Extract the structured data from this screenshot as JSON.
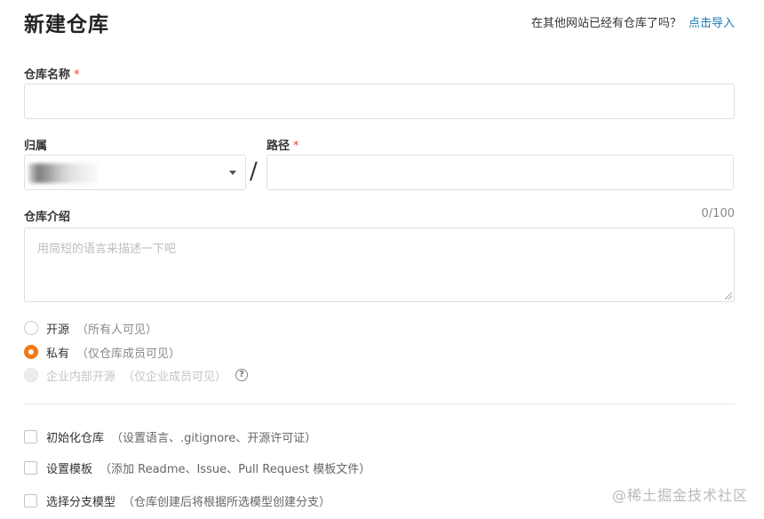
{
  "header": {
    "title": "新建仓库",
    "import_prompt": "在其他网站已经有仓库了吗？",
    "import_link": "点击导入"
  },
  "form": {
    "repo_name": {
      "label": "仓库名称",
      "required_mark": "*",
      "value": ""
    },
    "owner": {
      "label": "归属",
      "value": ""
    },
    "separator": "/",
    "path": {
      "label": "路径",
      "required_mark": "*",
      "value": ""
    },
    "description": {
      "label": "仓库介绍",
      "counter": "0/100",
      "placeholder": "用简短的语言来描述一下吧",
      "value": ""
    },
    "visibility": [
      {
        "label": "开源",
        "note": "（所有人可见）",
        "checked": false,
        "disabled": false
      },
      {
        "label": "私有",
        "note": "（仅仓库成员可见）",
        "checked": true,
        "disabled": false
      },
      {
        "label": "企业内部开源",
        "note": "（仅企业成员可见）",
        "checked": false,
        "disabled": true,
        "help": "?"
      }
    ],
    "options": [
      {
        "label": "初始化仓库",
        "note": "（设置语言、.gitignore、开源许可证）",
        "checked": false
      },
      {
        "label": "设置模板",
        "note": "（添加 Readme、Issue、Pull Request 模板文件）",
        "checked": false
      },
      {
        "label": "选择分支模型",
        "note": "（仓库创建后将根据所选模型创建分支）",
        "checked": false
      }
    ]
  },
  "watermark": "@稀土掘金技术社区",
  "colors": {
    "accent": "#f07a14",
    "link": "#1b7ab3",
    "required": "#e54545"
  }
}
